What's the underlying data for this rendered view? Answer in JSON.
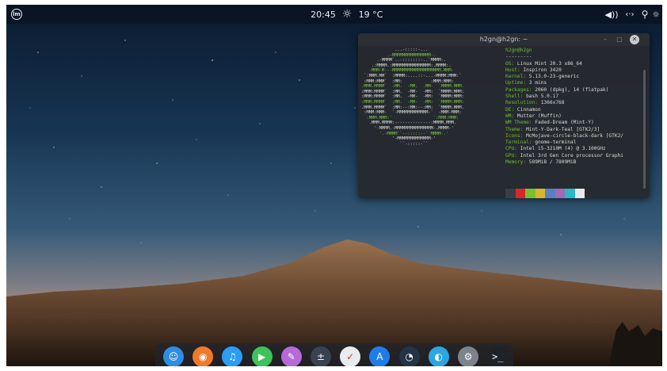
{
  "topbar": {
    "menu_label": "lm",
    "clock": "20:45",
    "weather_icon": "☼",
    "temperature": "19 °C",
    "tray": {
      "volume_glyph": "◀))",
      "network_glyph": "‹·›",
      "location_glyph": "⚲",
      "brightness_glyph": "☼"
    }
  },
  "terminal": {
    "title": "h2gn@h2gn: ~",
    "minimize_glyph": "–",
    "maximize_glyph": "□",
    "close_glyph": "✕",
    "ascii_art": {
      "white_lines": [
        "             ...-:::::-...",
        "          .-MMMMMMMMMMMMMMM-.",
        "      .-MMMM`..-:::::::-..`MMMM-.",
        "    .:MMMM.:MMMMMMMMMMMMMMM:.MMMM:.",
        "   -MMM-M---MMMMMMMMMMMMMMMMMMM.MMM-",
        " `:MMM:MM`  :MMMM:....::-...-MMMM:MMM:`",
        " :MMM:MMM`  :MM:           :MMM:MMM:",
        ".MMM.MMMM`  :MM.  -MM.  .MM-  `MMMM.MMM.",
        ":MMM:MMMM`  :MM.  -MM-  -MM:  `MMMM:MMM:",
        ":MMM:MMMM`  :MM.  -MM-  -MM:  `MMMM:MMM:",
        ":MMM:MMMM`  :MM.  -MM-  -MM:  `MMMM:MMM:",
        ".MMM.MMMM`  :MM:--:MM:--:MM:  `MMMM.MMM.",
        " :MMM:MMM-  `-MMMMMMMMMMMM-`  -MMM-MMM:",
        "  :MMM:MMM:`                `:MMM:MMM:",
        "   .MMM.MMMM:--------------:MMMM.MMM.",
        "     '-MMMM.-MMMMMMMMMMMMMMM-.MMMM-'",
        "       '.-MMMM``--:::::--``MMMM-.'",
        "            '-MMMMMMMMMMMMM-'",
        "               ``-:::::-``"
      ]
    },
    "info": {
      "header": "h2gn@h2gn",
      "separator": "---------",
      "lines": [
        {
          "key": "OS:",
          "value": " Linux Mint 20.3 x86_64"
        },
        {
          "key": "Host:",
          "value": " Inspiron 3420"
        },
        {
          "key": "Kernel:",
          "value": " 5.13.0-23-generic"
        },
        {
          "key": "Uptime:",
          "value": " 3 mins"
        },
        {
          "key": "Packages:",
          "value": " 2060 (dpkg), 14 (flatpak)"
        },
        {
          "key": "Shell:",
          "value": " bash 5.0.17"
        },
        {
          "key": "Resolution:",
          "value": " 1366x768"
        },
        {
          "key": "DE:",
          "value": " Cinnamon"
        },
        {
          "key": "WM:",
          "value": " Mutter (Muffin)"
        },
        {
          "key": "WM Theme:",
          "value": " Faded-Dream (Mint-Y)"
        },
        {
          "key": "Theme:",
          "value": " Mint-Y-Dark-Teal [GTK2/3]"
        },
        {
          "key": "Icons:",
          "value": " McMojave-circle-black-dark [GTK2/"
        },
        {
          "key": "Terminal:",
          "value": " gnome-terminal"
        },
        {
          "key": "CPU:",
          "value": " Intel i5-3210M (4) @ 3.100GHz"
        },
        {
          "key": "GPU:",
          "value": " Intel 3rd Gen Core processor Graphi"
        },
        {
          "key": "Memory:",
          "value": " 589MiB / 7809MiB"
        }
      ]
    },
    "palette": [
      "#3a3d42",
      "#d9262b",
      "#7cbf2e",
      "#d7b72c",
      "#5a7fc9",
      "#a06ab4",
      "#2bb6c9",
      "#e6e8ea"
    ]
  },
  "dock": {
    "items": [
      {
        "name": "finder",
        "glyph": "☺",
        "color": "#2f8de4"
      },
      {
        "name": "firefox",
        "glyph": "◉",
        "color": "#f2792a"
      },
      {
        "name": "music",
        "glyph": "♫",
        "color": "#2a9df4"
      },
      {
        "name": "media-player",
        "glyph": "▶",
        "color": "#3cc35a"
      },
      {
        "name": "text-editor",
        "glyph": "✎",
        "color": "#b56ad8"
      },
      {
        "name": "calculator",
        "glyph": "±",
        "color": "#394250"
      },
      {
        "name": "drawing",
        "glyph": "✓",
        "color": "#e8ecf0"
      },
      {
        "name": "app-store",
        "glyph": "A",
        "color": "#1f7de9"
      },
      {
        "name": "system-monitor",
        "glyph": "◔",
        "color": "#233447"
      },
      {
        "name": "software-manager",
        "glyph": "◐",
        "color": "#2ca6e0"
      },
      {
        "name": "settings",
        "glyph": "⚙",
        "color": "#7d838c"
      },
      {
        "name": "terminal",
        "glyph": ">_",
        "color": "#1e2329"
      }
    ]
  },
  "colors": {
    "accent_green": "#6fbf2e",
    "sky_top": "#0c1d33",
    "horizon_glow": "#c98a6a"
  }
}
